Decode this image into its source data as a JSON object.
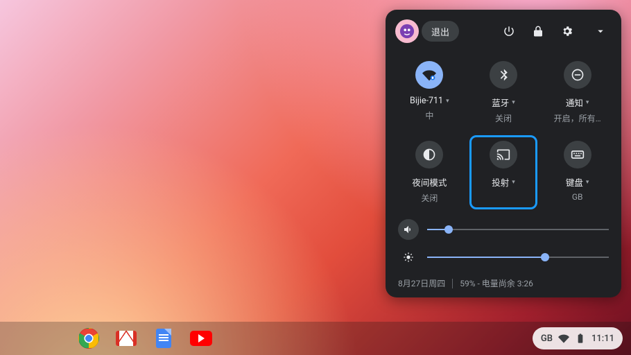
{
  "panel": {
    "signout": "退出",
    "tiles": [
      {
        "label": "Bijie-711",
        "sub": "中",
        "caret": true,
        "active": true
      },
      {
        "label": "蓝牙",
        "sub": "关闭",
        "caret": true,
        "active": false
      },
      {
        "label": "通知",
        "sub": "开启，所有…",
        "caret": true,
        "active": false
      },
      {
        "label": "夜间模式",
        "sub": "关闭",
        "caret": false,
        "active": false
      },
      {
        "label": "投射",
        "sub": "",
        "caret": true,
        "active": false,
        "highlight": true
      },
      {
        "label": "键盘",
        "sub": "GB",
        "caret": true,
        "active": false
      }
    ],
    "sliders": {
      "volume": 12,
      "brightness": 65
    },
    "footer": {
      "date": "8月27日周四",
      "battery": "59% - 电量尚余 3:26"
    }
  },
  "tray": {
    "ime": "GB",
    "clock": "11:11"
  }
}
